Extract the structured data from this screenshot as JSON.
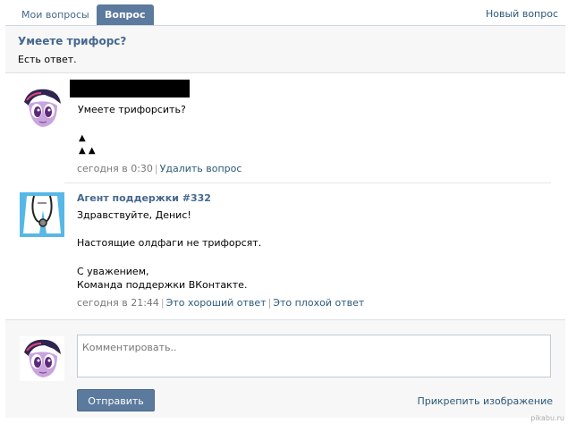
{
  "tabs": [
    {
      "label": "Мои вопросы",
      "active": false
    },
    {
      "label": "Вопрос",
      "active": true
    }
  ],
  "new_question_label": "Новый вопрос",
  "question": {
    "title": "Умеете трифорс?",
    "status": "Есть ответ."
  },
  "message1": {
    "text": "Умеете трифорсить?",
    "triforce": "▲\n▲ ▲",
    "time": "сегодня в 0:30",
    "delete_label": "Удалить вопрос"
  },
  "message2": {
    "author": "Агент поддержки #332",
    "greeting": "Здравствуйте, Денис!",
    "body": "Настоящие олдфаги не трифорсят.",
    "signoff": "С уважением,",
    "team": "Команда поддержки ВКонтакте.",
    "time": "сегодня в 21:44",
    "good_label": "Это хороший ответ",
    "bad_label": "Это плохой ответ"
  },
  "reply": {
    "placeholder": "Комментировать..",
    "send_label": "Отправить",
    "attach_label": "Прикрепить изображение"
  },
  "watermark": "pikabu.ru",
  "colors": {
    "link": "#2b587a",
    "accent": "#5b7a9d",
    "title": "#45688e"
  }
}
